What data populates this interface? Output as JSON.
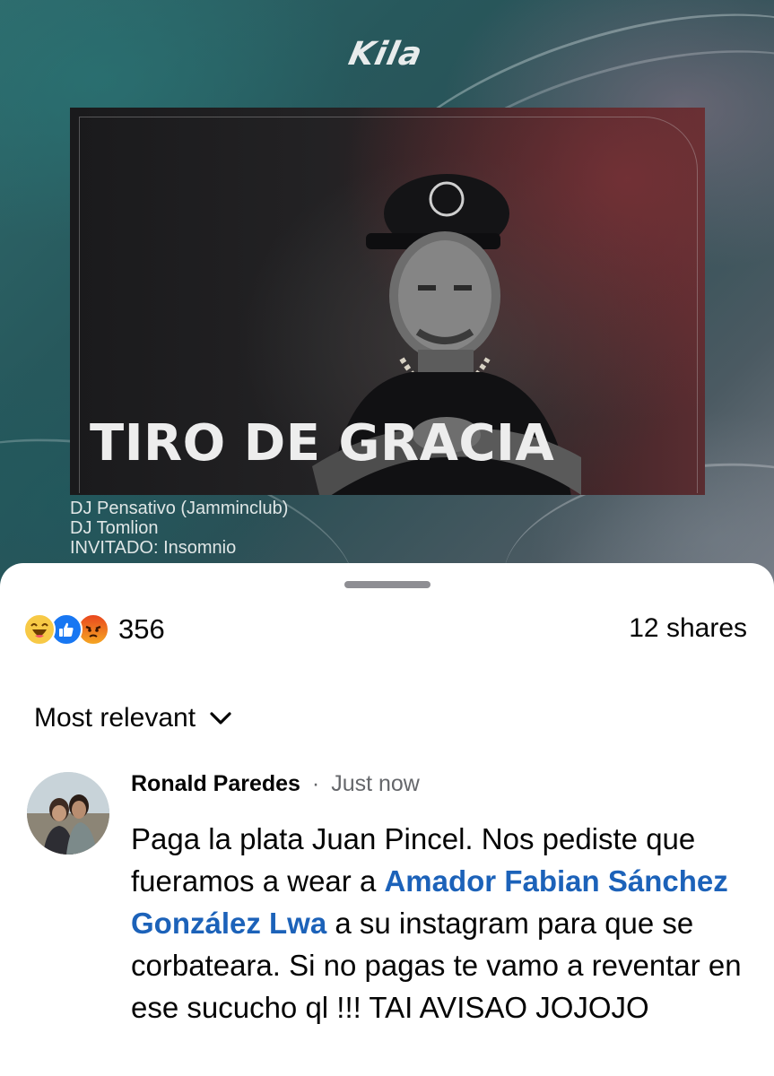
{
  "post": {
    "brand": "Kila",
    "headline": "TIRO DE GRACIA",
    "lineup": [
      "DJ Pensativo (Jamminclub)",
      "DJ Tomlion",
      "INVITADO: Insomnio"
    ]
  },
  "reactions": {
    "icons": [
      "haha-icon",
      "like-icon",
      "angry-icon"
    ],
    "count": "356",
    "shares": "12 shares"
  },
  "sort": {
    "label": "Most relevant",
    "icon": "chevron-down-icon"
  },
  "comment": {
    "author": "Ronald Paredes",
    "separator": "·",
    "time": "Just now",
    "text_before": "Paga la plata Juan Pincel. Nos pediste que fueramos a wear a ",
    "mention": "Amador Fabian Sánchez González Lwa",
    "text_after": " a su instagram para que se corbateara. Si no pagas te vamo a reventar en ese sucucho ql !!! TAI AVISAO JOJOJO"
  },
  "colors": {
    "like": "#1877f2",
    "haha": "#f7c946",
    "angry": "#e9471e",
    "mention": "#1c62b9",
    "muted": "#65676b"
  }
}
